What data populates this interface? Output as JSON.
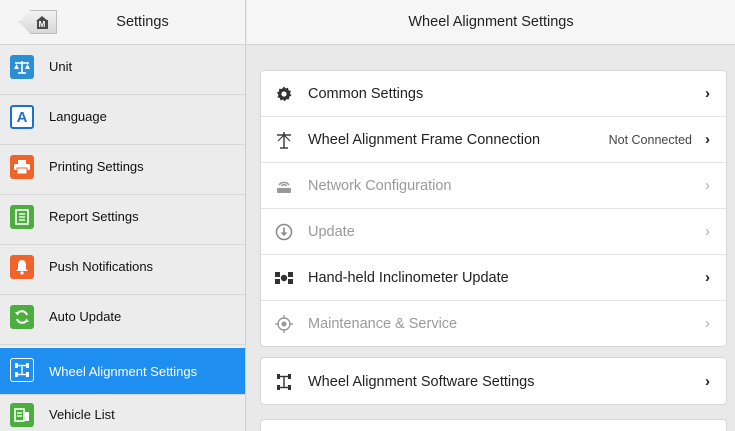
{
  "left_panel": {
    "title": "Settings",
    "items": [
      {
        "label": "Unit",
        "icon": "scale-icon",
        "color": "#2b8fd6"
      },
      {
        "label": "Language",
        "icon": "letter-a-icon",
        "color": "#1d6fcf"
      },
      {
        "label": "Printing Settings",
        "icon": "printer-icon",
        "color": "#f0642a"
      },
      {
        "label": "Report Settings",
        "icon": "report-icon",
        "color": "#4cae3e"
      },
      {
        "label": "Push Notifications",
        "icon": "bell-icon",
        "color": "#f0642a"
      },
      {
        "label": "Auto Update",
        "icon": "refresh-icon",
        "color": "#4cae3e"
      },
      {
        "label": "Wheel Alignment Settings",
        "icon": "wheel-alignment-icon",
        "color": "#1f8ef1"
      },
      {
        "label": "Vehicle List",
        "icon": "vehicle-list-icon",
        "color": "#4cae3e"
      }
    ],
    "active_index": 6,
    "accent": "#1f8ef1"
  },
  "right_panel": {
    "title": "Wheel Alignment Settings",
    "group1": [
      {
        "label": "Common Settings",
        "icon": "gear-icon",
        "status": "",
        "disabled": false
      },
      {
        "label": "Wheel Alignment Frame Connection",
        "icon": "frame-antenna-icon",
        "status": "Not Connected",
        "disabled": false
      },
      {
        "label": "Network Configuration",
        "icon": "router-icon",
        "status": "",
        "disabled": true
      },
      {
        "label": "Update",
        "icon": "download-circle-icon",
        "status": "",
        "disabled": true
      },
      {
        "label": "Hand-held Inclinometer Update",
        "icon": "inclinometer-icon",
        "status": "",
        "disabled": false
      },
      {
        "label": "Maintenance & Service",
        "icon": "crosshair-icon",
        "status": "",
        "disabled": true
      }
    ],
    "group2": [
      {
        "label": "Wheel Alignment Software Settings",
        "icon": "software-settings-icon",
        "status": "",
        "disabled": false
      }
    ],
    "chevron": "›"
  }
}
